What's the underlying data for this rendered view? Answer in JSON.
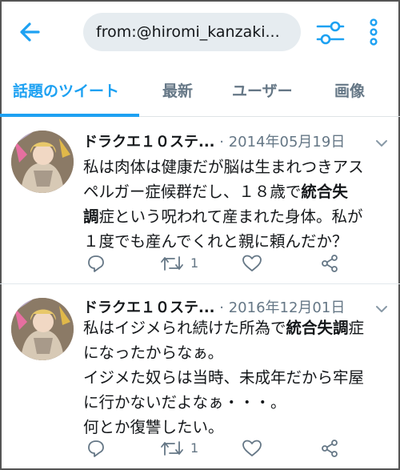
{
  "search": {
    "query": "from:@hiromi_kanzaki..."
  },
  "tabs": [
    {
      "label": "話題のツイート",
      "active": true
    },
    {
      "label": "最新"
    },
    {
      "label": "ユーザー"
    },
    {
      "label": "画像"
    }
  ],
  "colors": {
    "accent": "#1da1f2",
    "muted": "#657786"
  },
  "icons": [
    "back-arrow-icon",
    "filter-sliders-icon",
    "more-vertical-icon",
    "reply-icon",
    "retweet-icon",
    "like-icon",
    "share-icon",
    "caret-down-icon"
  ],
  "tweets": [
    {
      "name": "ドラクエ１０ステ...",
      "separator": "·",
      "date": "2014年05月19日",
      "line1": "私は肉体は健康だが脳は生まれつきアス",
      "line2_pre": "ペルガー症候群だし、１８歳で",
      "line2_bold": "統合失",
      "line3_bold": "調",
      "line3_post": "症という呪われて産まれた身体。私が",
      "line4": "１度でも産んでくれと親に頼んだか？",
      "retweets": "1"
    },
    {
      "name": "ドラクエ１０ステ...",
      "separator": "·",
      "date": "2016年12月01日",
      "line1_pre": "私はイジメられ続けた所為で",
      "line1_bold": "統合失調",
      "line1_post": "症",
      "line2": "になったからなぁ。",
      "line3": "イジメた奴らは当時、未成年だから牢屋",
      "line4": "に行かないだよなぁ・・・。",
      "line5": "何とか復讐したい。",
      "retweets": "1"
    }
  ]
}
